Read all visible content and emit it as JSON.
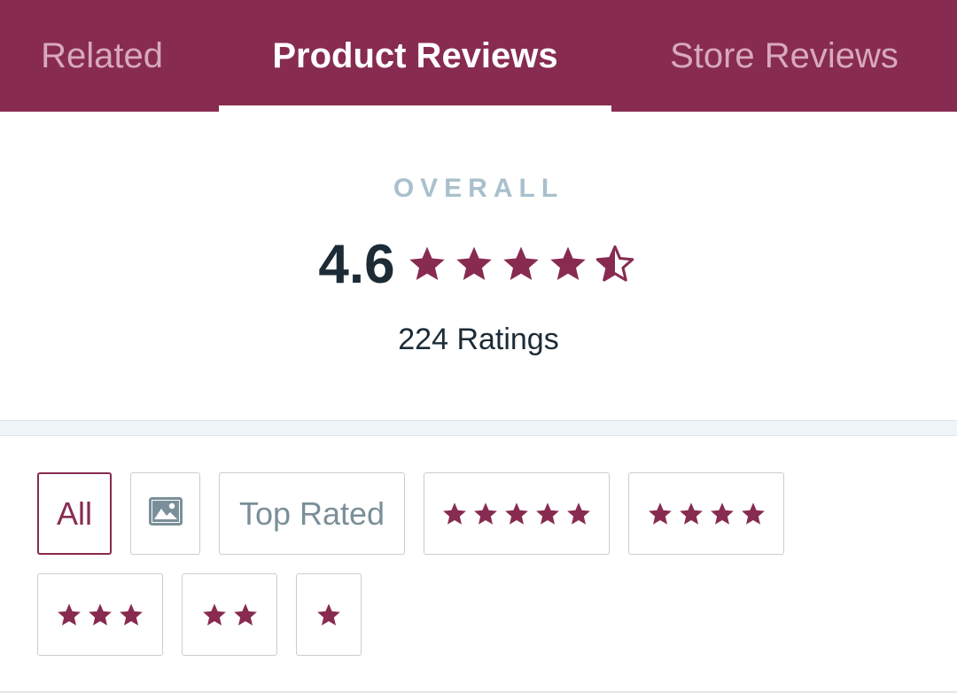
{
  "tabs": [
    {
      "label": "Related",
      "active": false
    },
    {
      "label": "Product Reviews",
      "active": true
    },
    {
      "label": "Store Reviews",
      "active": false
    }
  ],
  "overall": {
    "label": "OVERALL",
    "rating": "4.6",
    "rating_value": 4.6,
    "ratings_count": "224 Ratings"
  },
  "filters": [
    {
      "type": "text",
      "label": "All",
      "selected": true
    },
    {
      "type": "icon",
      "icon": "image-icon",
      "selected": false
    },
    {
      "type": "text",
      "label": "Top Rated",
      "selected": false
    },
    {
      "type": "stars",
      "stars": 5,
      "selected": false
    },
    {
      "type": "stars",
      "stars": 4,
      "selected": false
    },
    {
      "type": "stars",
      "stars": 3,
      "selected": false
    },
    {
      "type": "stars",
      "stars": 2,
      "selected": false
    },
    {
      "type": "stars",
      "stars": 1,
      "selected": false
    }
  ],
  "colors": {
    "brand": "#882b50",
    "tab_inactive": "#d7a9bb",
    "overall_label": "#a9c0cc",
    "text_dark": "#1c2b36",
    "chip_text": "#7a8f99",
    "chip_border": "#c9ced3"
  }
}
